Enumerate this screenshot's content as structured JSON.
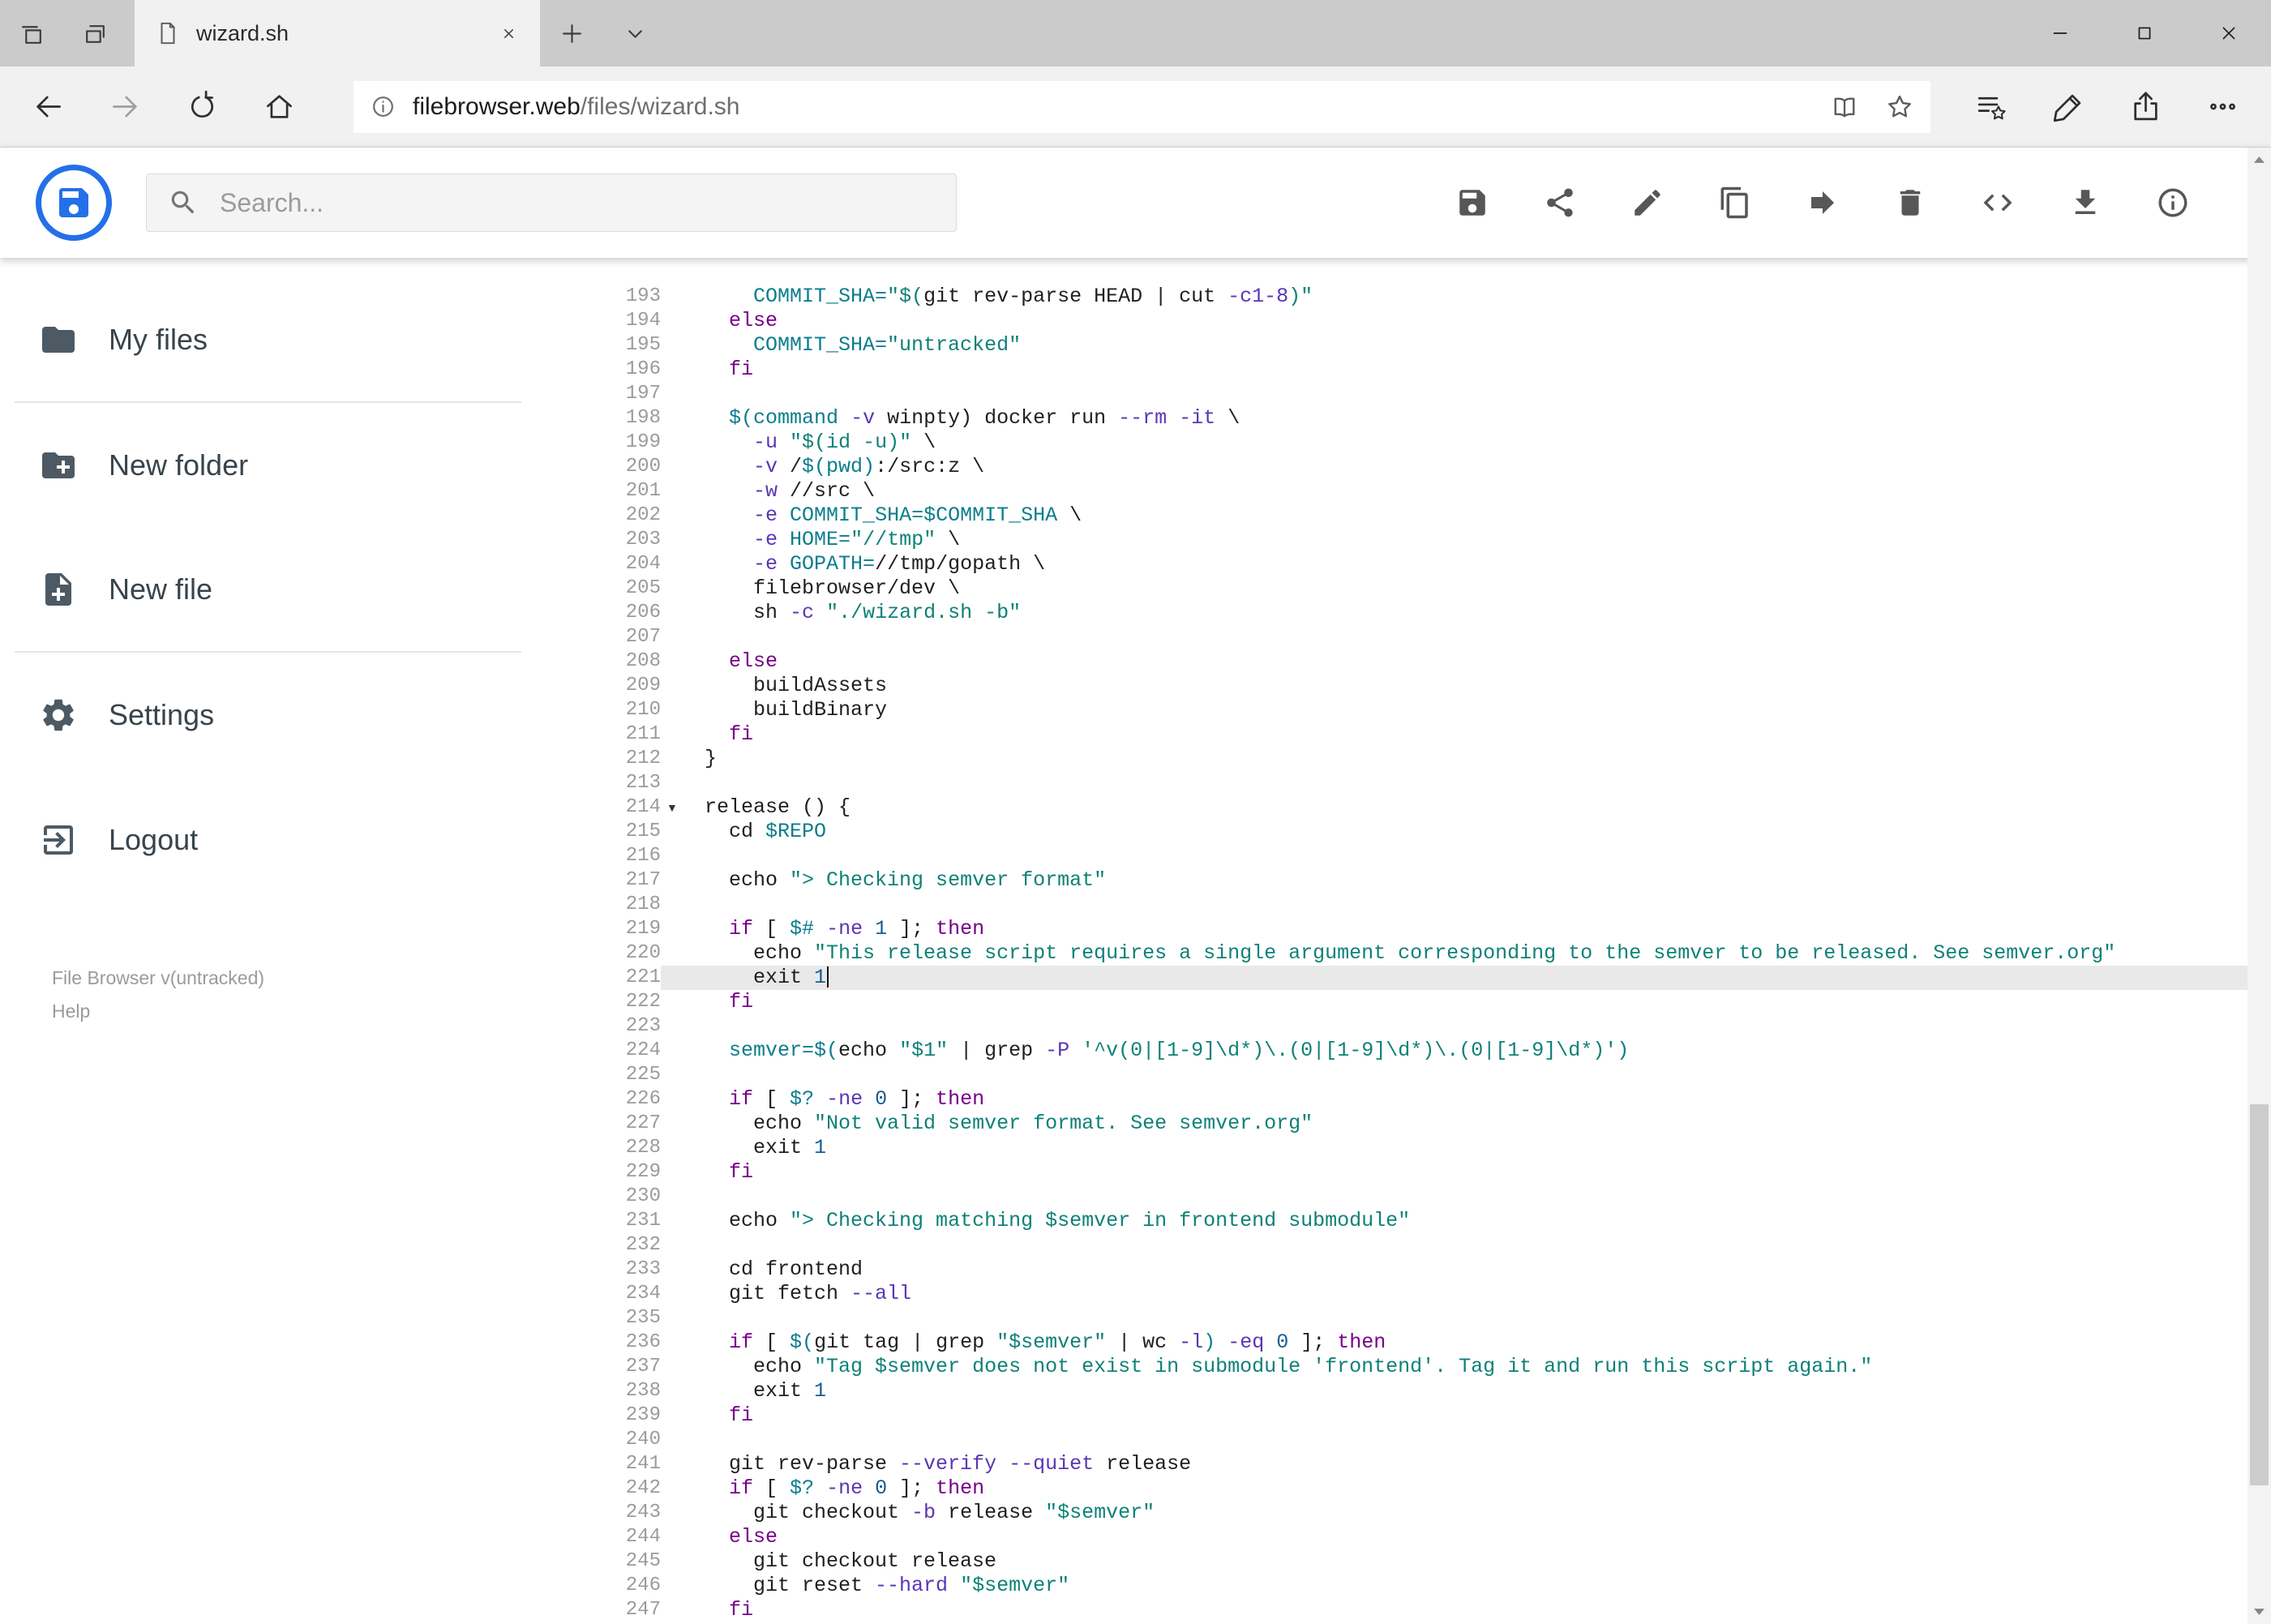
{
  "browser": {
    "tab": {
      "title": "wizard.sh"
    },
    "url": {
      "domain": "filebrowser.web",
      "path": "/files/wizard.sh"
    }
  },
  "app": {
    "search": {
      "placeholder": "Search..."
    },
    "toolbar": [
      {
        "name": "save-icon",
        "button": "save-button"
      },
      {
        "name": "share-icon",
        "button": "share-button"
      },
      {
        "name": "edit-icon",
        "button": "rename-button"
      },
      {
        "name": "copy-icon",
        "button": "copy-button"
      },
      {
        "name": "move-icon",
        "button": "move-button"
      },
      {
        "name": "delete-icon",
        "button": "delete-button"
      },
      {
        "name": "code-icon",
        "button": "code-view-button"
      },
      {
        "name": "download-icon",
        "button": "download-button"
      },
      {
        "name": "info-icon",
        "button": "info-button"
      }
    ],
    "sidebar": {
      "items": [
        {
          "label": "My files",
          "icon": "folder-icon",
          "divider_after": true
        },
        {
          "label": "New folder",
          "icon": "new-folder-icon",
          "divider_after": false
        },
        {
          "label": "New file",
          "icon": "new-file-icon",
          "divider_after": true
        },
        {
          "label": "Settings",
          "icon": "settings-icon",
          "divider_after": false
        },
        {
          "label": "Logout",
          "icon": "logout-icon",
          "divider_after": false
        }
      ],
      "footer": {
        "version": "File Browser v(untracked)",
        "help": "Help"
      }
    }
  },
  "editor": {
    "active_line": 221,
    "cursor_line": 221,
    "fold_open_line": 214,
    "colors": {
      "plain": "#1f1f1f",
      "keyword": "#770088",
      "string": "#0e8177",
      "variable": "#0b7d8c",
      "attribute": "#5a35b5",
      "number": "#155d92",
      "gutter": "#9b9b9b",
      "active_line_bg": "#e9e9e9"
    },
    "lines": [
      {
        "n": 193,
        "t": [
          [
            "p",
            "    "
          ],
          [
            "v",
            "COMMIT_SHA="
          ],
          [
            "s",
            "\"$("
          ],
          [
            "p",
            "git rev-parse HEAD | cut "
          ],
          [
            "a",
            "-c1-8"
          ],
          [
            "s",
            ")\""
          ]
        ]
      },
      {
        "n": 194,
        "t": [
          [
            "p",
            "  "
          ],
          [
            "k",
            "else"
          ]
        ]
      },
      {
        "n": 195,
        "t": [
          [
            "p",
            "    "
          ],
          [
            "v",
            "COMMIT_SHA="
          ],
          [
            "s",
            "\"untracked\""
          ]
        ]
      },
      {
        "n": 196,
        "t": [
          [
            "p",
            "  "
          ],
          [
            "k",
            "fi"
          ]
        ]
      },
      {
        "n": 197,
        "t": []
      },
      {
        "n": 198,
        "t": [
          [
            "p",
            "  "
          ],
          [
            "v",
            "$(command"
          ],
          [
            "p",
            " "
          ],
          [
            "a",
            "-v"
          ],
          [
            "p",
            " winpty) docker run "
          ],
          [
            "a",
            "--rm"
          ],
          [
            "p",
            " "
          ],
          [
            "a",
            "-it"
          ],
          [
            "p",
            " \\"
          ]
        ]
      },
      {
        "n": 199,
        "t": [
          [
            "p",
            "    "
          ],
          [
            "a",
            "-u"
          ],
          [
            "p",
            " "
          ],
          [
            "s",
            "\"$(id -u)\""
          ],
          [
            "p",
            " \\"
          ]
        ]
      },
      {
        "n": 200,
        "t": [
          [
            "p",
            "    "
          ],
          [
            "a",
            "-v"
          ],
          [
            "p",
            " /"
          ],
          [
            "v",
            "$(pwd)"
          ],
          [
            "p",
            ":/src:z \\"
          ]
        ]
      },
      {
        "n": 201,
        "t": [
          [
            "p",
            "    "
          ],
          [
            "a",
            "-w"
          ],
          [
            "p",
            " //src \\"
          ]
        ]
      },
      {
        "n": 202,
        "t": [
          [
            "p",
            "    "
          ],
          [
            "a",
            "-e"
          ],
          [
            "p",
            " "
          ],
          [
            "v",
            "COMMIT_SHA=$COMMIT_SHA"
          ],
          [
            "p",
            " \\"
          ]
        ]
      },
      {
        "n": 203,
        "t": [
          [
            "p",
            "    "
          ],
          [
            "a",
            "-e"
          ],
          [
            "p",
            " "
          ],
          [
            "v",
            "HOME="
          ],
          [
            "s",
            "\"//tmp\""
          ],
          [
            "p",
            " \\"
          ]
        ]
      },
      {
        "n": 204,
        "t": [
          [
            "p",
            "    "
          ],
          [
            "a",
            "-e"
          ],
          [
            "p",
            " "
          ],
          [
            "v",
            "GOPATH="
          ],
          [
            "p",
            "//tmp/gopath \\"
          ]
        ]
      },
      {
        "n": 205,
        "t": [
          [
            "p",
            "    filebrowser/dev \\"
          ]
        ]
      },
      {
        "n": 206,
        "t": [
          [
            "p",
            "    sh "
          ],
          [
            "a",
            "-c"
          ],
          [
            "p",
            " "
          ],
          [
            "s",
            "\"./wizard.sh -b\""
          ]
        ]
      },
      {
        "n": 207,
        "t": []
      },
      {
        "n": 208,
        "t": [
          [
            "p",
            "  "
          ],
          [
            "k",
            "else"
          ]
        ]
      },
      {
        "n": 209,
        "t": [
          [
            "p",
            "    buildAssets"
          ]
        ]
      },
      {
        "n": 210,
        "t": [
          [
            "p",
            "    buildBinary"
          ]
        ]
      },
      {
        "n": 211,
        "t": [
          [
            "p",
            "  "
          ],
          [
            "k",
            "fi"
          ]
        ]
      },
      {
        "n": 212,
        "t": [
          [
            "p",
            "}"
          ]
        ]
      },
      {
        "n": 213,
        "t": []
      },
      {
        "n": 214,
        "t": [
          [
            "p",
            "release () {"
          ]
        ]
      },
      {
        "n": 215,
        "t": [
          [
            "p",
            "  cd "
          ],
          [
            "v",
            "$REPO"
          ]
        ]
      },
      {
        "n": 216,
        "t": []
      },
      {
        "n": 217,
        "t": [
          [
            "p",
            "  echo "
          ],
          [
            "s",
            "\"> Checking semver format\""
          ]
        ]
      },
      {
        "n": 218,
        "t": []
      },
      {
        "n": 219,
        "t": [
          [
            "p",
            "  "
          ],
          [
            "k",
            "if"
          ],
          [
            "p",
            " [ "
          ],
          [
            "v",
            "$#"
          ],
          [
            "p",
            " "
          ],
          [
            "a",
            "-ne"
          ],
          [
            "p",
            " "
          ],
          [
            "d",
            "1"
          ],
          [
            "p",
            " ]; "
          ],
          [
            "k",
            "then"
          ]
        ]
      },
      {
        "n": 220,
        "t": [
          [
            "p",
            "    echo "
          ],
          [
            "s",
            "\"This release script requires a single argument corresponding to the semver to be released. See semver.org\""
          ]
        ]
      },
      {
        "n": 221,
        "t": [
          [
            "p",
            "    exit "
          ],
          [
            "d",
            "1"
          ]
        ]
      },
      {
        "n": 222,
        "t": [
          [
            "p",
            "  "
          ],
          [
            "k",
            "fi"
          ]
        ]
      },
      {
        "n": 223,
        "t": []
      },
      {
        "n": 224,
        "t": [
          [
            "p",
            "  "
          ],
          [
            "v",
            "semver=$("
          ],
          [
            "p",
            "echo "
          ],
          [
            "s",
            "\"$1\""
          ],
          [
            "p",
            " | grep "
          ],
          [
            "a",
            "-P"
          ],
          [
            "p",
            " "
          ],
          [
            "s",
            "'^v(0|[1-9]\\d*)\\.(0|[1-9]\\d*)\\.(0|[1-9]\\d*)'"
          ],
          [
            "v",
            ")"
          ]
        ]
      },
      {
        "n": 225,
        "t": []
      },
      {
        "n": 226,
        "t": [
          [
            "p",
            "  "
          ],
          [
            "k",
            "if"
          ],
          [
            "p",
            " [ "
          ],
          [
            "v",
            "$?"
          ],
          [
            "p",
            " "
          ],
          [
            "a",
            "-ne"
          ],
          [
            "p",
            " "
          ],
          [
            "d",
            "0"
          ],
          [
            "p",
            " ]; "
          ],
          [
            "k",
            "then"
          ]
        ]
      },
      {
        "n": 227,
        "t": [
          [
            "p",
            "    echo "
          ],
          [
            "s",
            "\"Not valid semver format. See semver.org\""
          ]
        ]
      },
      {
        "n": 228,
        "t": [
          [
            "p",
            "    exit "
          ],
          [
            "d",
            "1"
          ]
        ]
      },
      {
        "n": 229,
        "t": [
          [
            "p",
            "  "
          ],
          [
            "k",
            "fi"
          ]
        ]
      },
      {
        "n": 230,
        "t": []
      },
      {
        "n": 231,
        "t": [
          [
            "p",
            "  echo "
          ],
          [
            "s",
            "\"> Checking matching $semver in frontend submodule\""
          ]
        ]
      },
      {
        "n": 232,
        "t": []
      },
      {
        "n": 233,
        "t": [
          [
            "p",
            "  cd frontend"
          ]
        ]
      },
      {
        "n": 234,
        "t": [
          [
            "p",
            "  git fetch "
          ],
          [
            "a",
            "--all"
          ]
        ]
      },
      {
        "n": 235,
        "t": []
      },
      {
        "n": 236,
        "t": [
          [
            "p",
            "  "
          ],
          [
            "k",
            "if"
          ],
          [
            "p",
            " [ "
          ],
          [
            "v",
            "$("
          ],
          [
            "p",
            "git tag | grep "
          ],
          [
            "s",
            "\"$semver\""
          ],
          [
            "p",
            " | wc "
          ],
          [
            "a",
            "-l"
          ],
          [
            "v",
            ")"
          ],
          [
            "p",
            " "
          ],
          [
            "a",
            "-eq"
          ],
          [
            "p",
            " "
          ],
          [
            "d",
            "0"
          ],
          [
            "p",
            " ]; "
          ],
          [
            "k",
            "then"
          ]
        ]
      },
      {
        "n": 237,
        "t": [
          [
            "p",
            "    echo "
          ],
          [
            "s",
            "\"Tag $semver does not exist in submodule 'frontend'. Tag it and run this script again.\""
          ]
        ]
      },
      {
        "n": 238,
        "t": [
          [
            "p",
            "    exit "
          ],
          [
            "d",
            "1"
          ]
        ]
      },
      {
        "n": 239,
        "t": [
          [
            "p",
            "  "
          ],
          [
            "k",
            "fi"
          ]
        ]
      },
      {
        "n": 240,
        "t": []
      },
      {
        "n": 241,
        "t": [
          [
            "p",
            "  git rev-parse "
          ],
          [
            "a",
            "--verify"
          ],
          [
            "p",
            " "
          ],
          [
            "a",
            "--quiet"
          ],
          [
            "p",
            " release"
          ]
        ]
      },
      {
        "n": 242,
        "t": [
          [
            "p",
            "  "
          ],
          [
            "k",
            "if"
          ],
          [
            "p",
            " [ "
          ],
          [
            "v",
            "$?"
          ],
          [
            "p",
            " "
          ],
          [
            "a",
            "-ne"
          ],
          [
            "p",
            " "
          ],
          [
            "d",
            "0"
          ],
          [
            "p",
            " ]; "
          ],
          [
            "k",
            "then"
          ]
        ]
      },
      {
        "n": 243,
        "t": [
          [
            "p",
            "    git checkout "
          ],
          [
            "a",
            "-b"
          ],
          [
            "p",
            " release "
          ],
          [
            "s",
            "\"$semver\""
          ]
        ]
      },
      {
        "n": 244,
        "t": [
          [
            "p",
            "  "
          ],
          [
            "k",
            "else"
          ]
        ]
      },
      {
        "n": 245,
        "t": [
          [
            "p",
            "    git checkout release"
          ]
        ]
      },
      {
        "n": 246,
        "t": [
          [
            "p",
            "    git reset "
          ],
          [
            "a",
            "--hard"
          ],
          [
            "p",
            " "
          ],
          [
            "s",
            "\"$semver\""
          ]
        ]
      },
      {
        "n": 247,
        "t": [
          [
            "p",
            "  "
          ],
          [
            "k",
            "fi"
          ]
        ]
      }
    ]
  }
}
